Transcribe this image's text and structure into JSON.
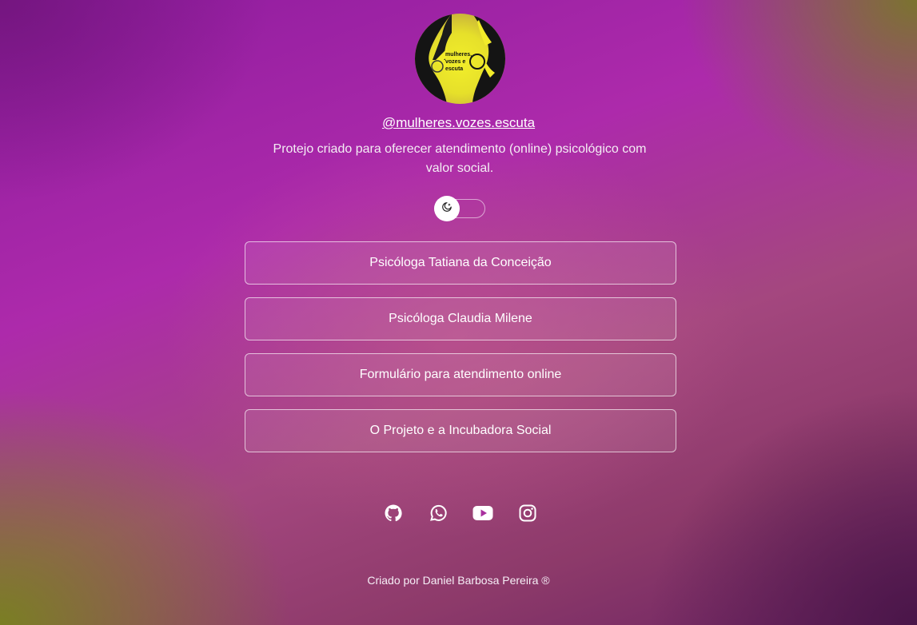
{
  "profile": {
    "avatar_text": "mulheres, vozes e escuta",
    "handle": "@mulheres.vozes.escuta",
    "bio": "Protejo criado para oferecer atendimento (online) psicológico com valor social."
  },
  "theme_toggle": {
    "icon": "moon-icon",
    "state": "off"
  },
  "links": [
    {
      "label": "Psicóloga Tatiana da Conceição"
    },
    {
      "label": "Psicóloga Claudia Milene"
    },
    {
      "label": "Formulário para atendimento online"
    },
    {
      "label": "O Projeto e a Incubadora Social"
    }
  ],
  "socials": [
    {
      "icon": "github-icon"
    },
    {
      "icon": "whatsapp-icon"
    },
    {
      "icon": "youtube-icon"
    },
    {
      "icon": "instagram-icon"
    }
  ],
  "footer": {
    "text": "Criado por Daniel Barbosa Pereira ®"
  },
  "colors": {
    "primary": "#a8229f",
    "accent_yellow": "#efe82c",
    "text": "#ffffff"
  }
}
